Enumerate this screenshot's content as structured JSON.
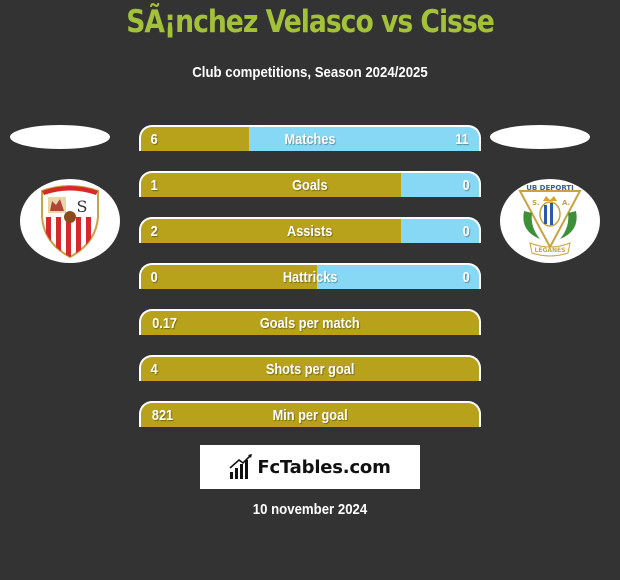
{
  "header": {
    "title": "SÃ¡nchez Velasco vs Cisse",
    "subtitle": "Club competitions, Season 2024/2025"
  },
  "teams": {
    "left": {
      "name": "Sevilla",
      "crest_icon": "sevilla-crest-icon"
    },
    "right": {
      "name": "Leganes",
      "crest_icon": "leganes-crest-icon"
    }
  },
  "colors": {
    "background": "#333333",
    "title": "#a4c13a",
    "left_fill": "#b8a11b",
    "right_fill": "#87d8f5"
  },
  "stats": [
    {
      "label": "Matches",
      "left": "6",
      "right": "11",
      "left_fraction": 0.32
    },
    {
      "label": "Goals",
      "left": "1",
      "right": "0",
      "left_fraction": 0.77
    },
    {
      "label": "Assists",
      "left": "2",
      "right": "0",
      "left_fraction": 0.77
    },
    {
      "label": "Hattricks",
      "left": "0",
      "right": "0",
      "left_fraction": 0.52
    },
    {
      "label": "Goals per match",
      "left": "0.17",
      "right": "",
      "left_fraction": 1.0
    },
    {
      "label": "Shots per goal",
      "left": "4",
      "right": "",
      "left_fraction": 1.0
    },
    {
      "label": "Min per goal",
      "left": "821",
      "right": "",
      "left_fraction": 1.0
    }
  ],
  "footer": {
    "brand": "FcTables.com",
    "brand_icon": "bar-chart-icon",
    "date": "10 november 2024"
  }
}
